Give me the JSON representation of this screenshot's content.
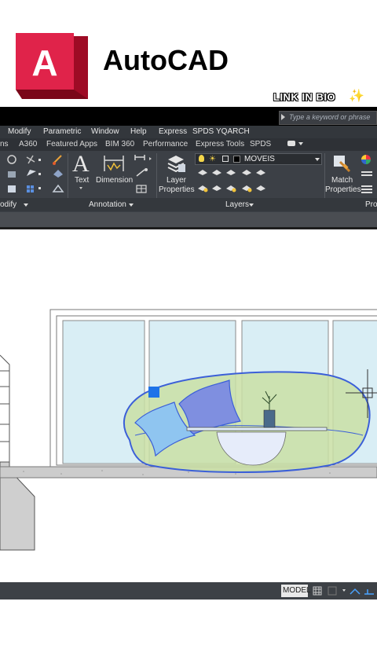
{
  "brand": {
    "app_name": "AutoCAD",
    "logo_letter": "A",
    "overlay_text": "LINK IN BIO",
    "sparkle_icon": "✨",
    "accent_color": "#c8102e"
  },
  "search": {
    "placeholder": "Type a keyword or phrase"
  },
  "menubar": {
    "items": [
      "Modify",
      "Parametric",
      "Window",
      "Help",
      "Express",
      "SPDS",
      "YQARCH"
    ]
  },
  "ribbon_tabs": {
    "items": [
      "ns",
      "A360",
      "Featured Apps",
      "BIM 360",
      "Performance",
      "Express Tools",
      "SPDS"
    ]
  },
  "ribbon": {
    "text_tool": "Text",
    "dimension_tool": "Dimension",
    "layer_properties_line1": "Layer",
    "layer_properties_line2": "Properties",
    "current_layer": "MOVEIS",
    "match_properties_line1": "Match",
    "match_properties_line2": "Properties"
  },
  "panels": {
    "modify": "odify",
    "annotation": "Annotation",
    "layers": "Layers",
    "properties": "Pro"
  },
  "statusbar": {
    "model_tab": "MODEL"
  },
  "colors": {
    "ribbon_bg": "#3c4046",
    "window_glass": "#d9eef5",
    "sofa_fill": "#c9dfa4",
    "cushion_dark": "#7f8fe0",
    "cushion_light": "#8fc5f0",
    "selection": "#3b5fd8"
  }
}
